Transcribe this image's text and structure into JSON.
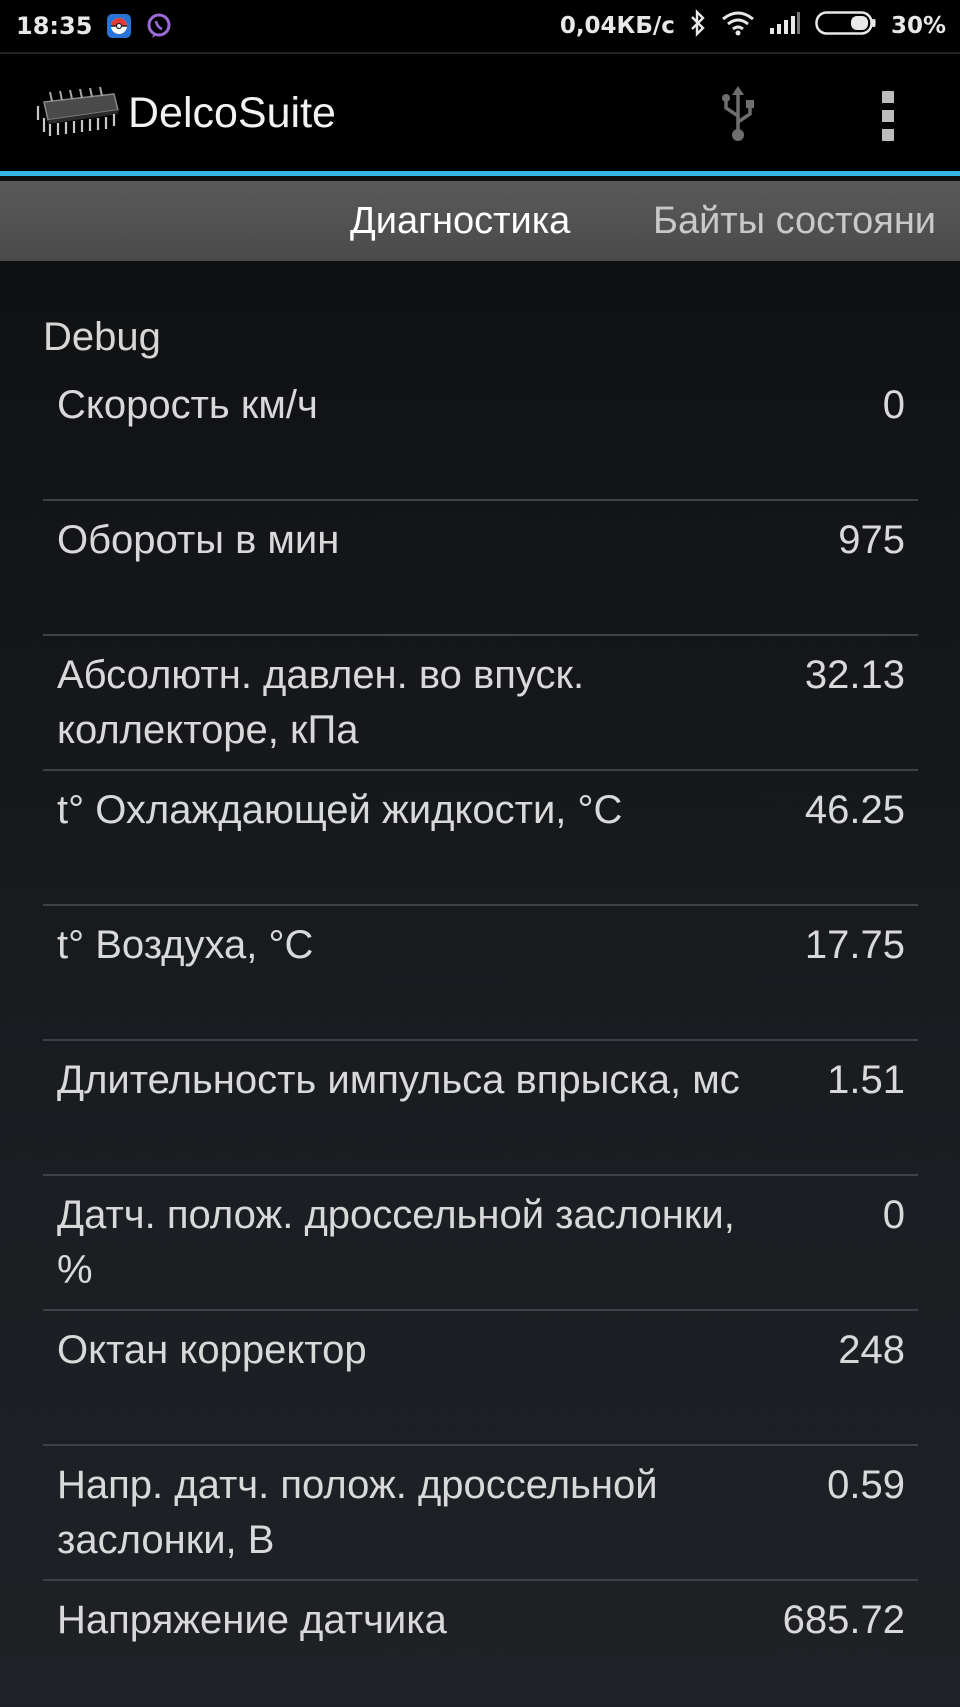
{
  "status_bar": {
    "time": "18:35",
    "notifications": [
      "pokemon-icon",
      "viber-icon"
    ],
    "net_speed": "0,04КБ/с",
    "icons": [
      "bluetooth-icon",
      "wifi-icon",
      "signal-icon",
      "battery-icon"
    ],
    "battery": "30%"
  },
  "app_bar": {
    "title": "DelcoSuite",
    "logo_icon": "chip-icon",
    "actions": [
      "usb-icon",
      "overflow-menu-icon"
    ]
  },
  "tabs": [
    {
      "label": "Диагностика",
      "active": true
    },
    {
      "label": "Байты состояни",
      "active": false
    }
  ],
  "section": {
    "title": "Debug"
  },
  "parameters": [
    {
      "label": "Скорость км/ч",
      "value": "0"
    },
    {
      "label": "Обороты в мин",
      "value": "975"
    },
    {
      "label": "Абсолютн. давлен. во впуск. коллекторе, кПа",
      "value": "32.13"
    },
    {
      "label": "t° Охлаждающей жидкости, °C",
      "value": "46.25"
    },
    {
      "label": "t° Воздуха, °C",
      "value": "17.75"
    },
    {
      "label": "Длительность импульса впрыска, мс",
      "value": "1.51"
    },
    {
      "label": "Датч. полож. дроссельной заслонки, %",
      "value": "0"
    },
    {
      "label": "Октан корректор",
      "value": "248"
    },
    {
      "label": "Напр. датч. полож. дроссельной заслонки, В",
      "value": "0.59"
    },
    {
      "label": "Напряжение датчика",
      "value": "685.72"
    }
  ],
  "colors": {
    "accent": "#33b5e5",
    "tab_strip": "#4e4e4e",
    "divider": "#3e4147"
  }
}
